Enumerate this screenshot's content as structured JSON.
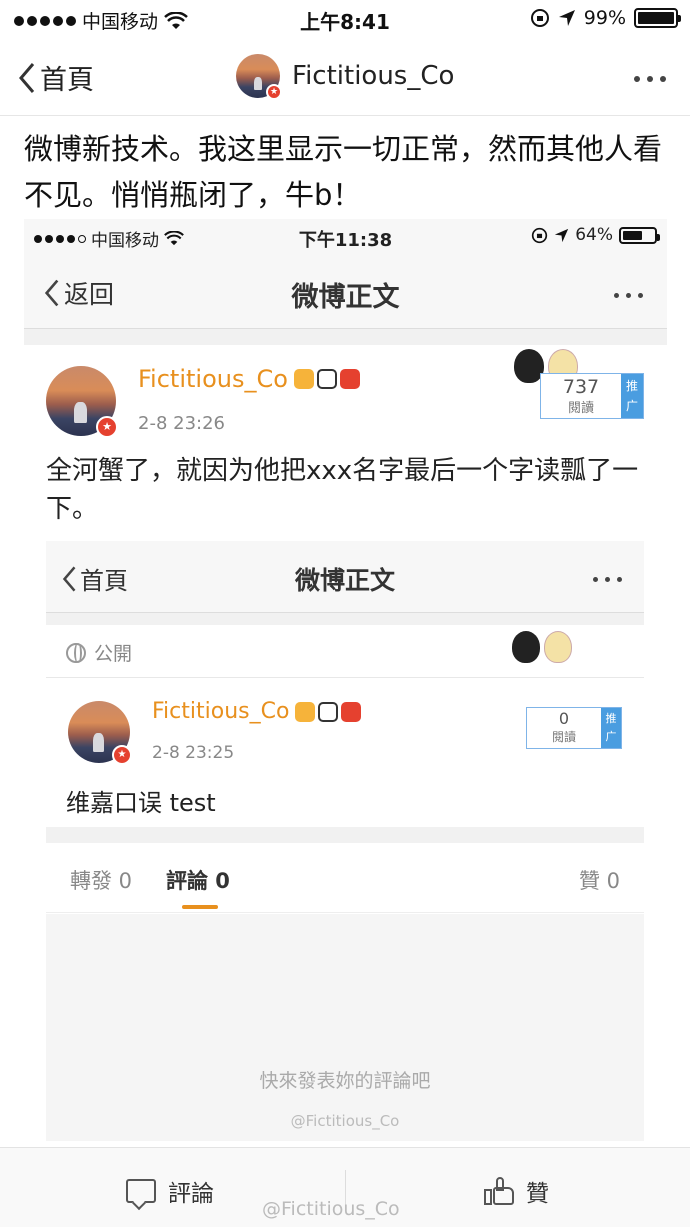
{
  "status_bar": {
    "carrier": "中国移动",
    "time": "上午8:41",
    "battery": "99%",
    "battery_level": 0.99
  },
  "nav": {
    "back_label": "首頁",
    "title": "Fictitious_Co"
  },
  "post_text": "微博新技术。我这里显示一切正常，然而其他人看不见。悄悄瓶闭了，牛b！",
  "screenshot1": {
    "status_bar": {
      "carrier": "中国移动",
      "time": "下午11:38",
      "battery": "64%",
      "battery_level": 0.64
    },
    "nav": {
      "back_label": "返回",
      "title": "微博正文"
    },
    "author": "Fictitious_Co",
    "date": "2-8 23:26",
    "read_count": "737",
    "read_label": "閱讀",
    "promote_label": "推广",
    "text": "全河蟹了，就因为他把xxx名字最后一个字读瓢了一下。"
  },
  "screenshot2": {
    "nav": {
      "back_label": "首頁",
      "title": "微博正文"
    },
    "visibility": "公開",
    "author": "Fictitious_Co",
    "date": "2-8 23:25",
    "read_count": "0",
    "read_label": "閱讀",
    "promote_label": "推广",
    "text": "维嘉口误 test",
    "tabs": {
      "repost": "轉發 0",
      "comment": "評論 0",
      "like": "贊 0"
    },
    "empty_hint": "快來發表妳的評論吧",
    "watermark": "@Fictitious_Co"
  },
  "bottom_bar": {
    "comment_label": "評論",
    "like_label": "贊",
    "watermark": "@Fictitious_Co"
  },
  "colors": {
    "name_orange": "#e8901e",
    "promote_blue": "#4a9de0",
    "badge_red": "#e5412f"
  },
  "icons": [
    "signal-dots",
    "wifi-icon",
    "location-icon",
    "battery-icon",
    "back-chevron-icon",
    "more-icon",
    "globe-icon",
    "comment-icon",
    "like-icon"
  ]
}
